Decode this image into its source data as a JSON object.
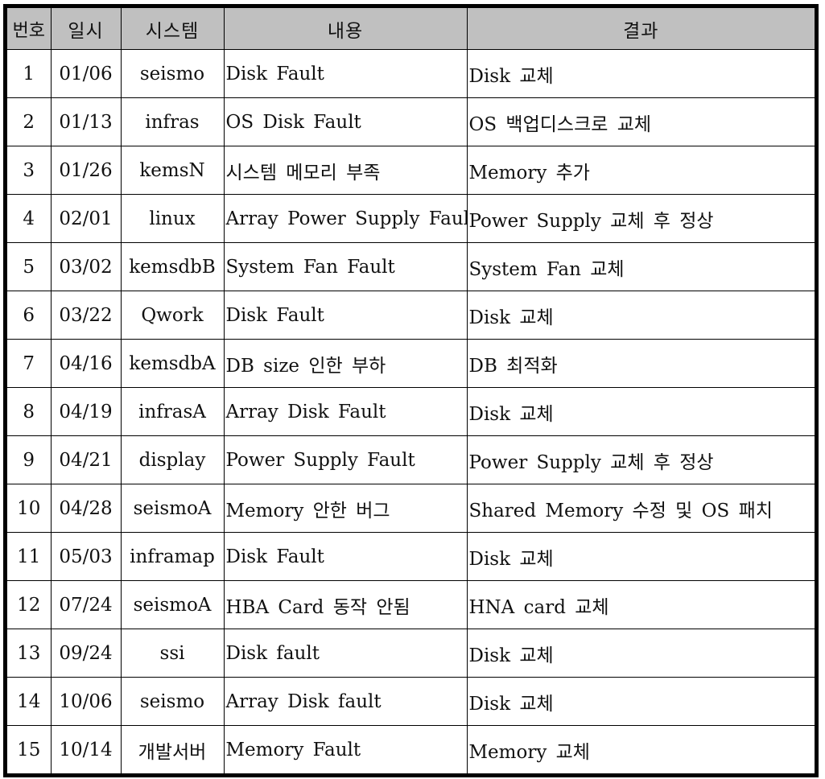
{
  "table": {
    "headers": {
      "no": "번호",
      "date": "일시",
      "system": "시스템",
      "description": "내용",
      "result": "결과"
    },
    "rows": [
      {
        "no": "1",
        "date": "01/06",
        "system": "seismo",
        "description": "Disk Fault",
        "result": "Disk 교체"
      },
      {
        "no": "2",
        "date": "01/13",
        "system": "infras",
        "description": "OS Disk Fault",
        "result": "OS 백업디스크로 교체"
      },
      {
        "no": "3",
        "date": "01/26",
        "system": "kemsN",
        "description": "시스템 메모리 부족",
        "result": "Memory 추가"
      },
      {
        "no": "4",
        "date": "02/01",
        "system": "linux",
        "description": "Array Power Supply Fault",
        "result": "Power Supply 교체 후 정상"
      },
      {
        "no": "5",
        "date": "03/02",
        "system": "kemsdbB",
        "description": "System Fan Fault",
        "result": "System Fan 교체"
      },
      {
        "no": "6",
        "date": "03/22",
        "system": "Qwork",
        "description": "Disk Fault",
        "result": "Disk 교체"
      },
      {
        "no": "7",
        "date": "04/16",
        "system": "kemsdbA",
        "description": "DB size  인한 부하",
        "result": "DB 최적화"
      },
      {
        "no": "8",
        "date": "04/19",
        "system": "infrasA",
        "description": "Array Disk Fault",
        "result": "Disk 교체"
      },
      {
        "no": "9",
        "date": "04/21",
        "system": "display",
        "description": "Power Supply Fault",
        "result": "Power Supply 교체 후 정상"
      },
      {
        "no": "10",
        "date": "04/28",
        "system": "seismoA",
        "description": "Memory 안한 버그",
        "result": "Shared Memory 수정 및 OS 패치"
      },
      {
        "no": "11",
        "date": "05/03",
        "system": "inframap",
        "description": "Disk Fault",
        "result": "Disk 교체"
      },
      {
        "no": "12",
        "date": "07/24",
        "system": "seismoA",
        "description": "HBA Card 동작 안됨",
        "result": "HNA card 교체"
      },
      {
        "no": "13",
        "date": "09/24",
        "system": "ssi",
        "description": "Disk fault",
        "result": "Disk 교체"
      },
      {
        "no": "14",
        "date": "10/06",
        "system": "seismo",
        "description": "Array Disk fault",
        "result": "Disk 교체"
      },
      {
        "no": "15",
        "date": "10/14",
        "system": "개발서버",
        "description": "Memory Fault",
        "result": "Memory 교체"
      }
    ]
  }
}
